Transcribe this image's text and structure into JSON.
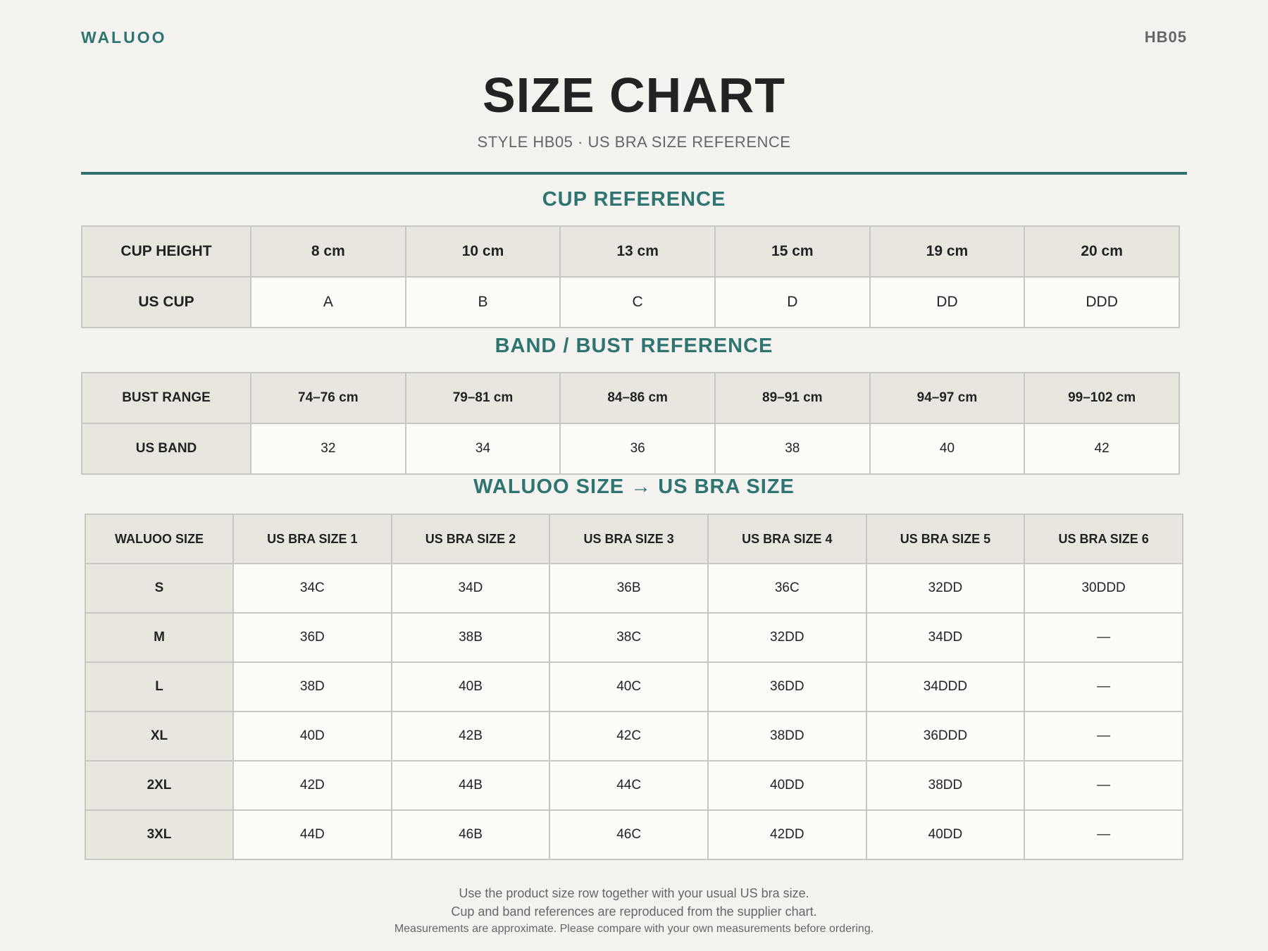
{
  "header": {
    "brand": "WALUOO",
    "code": "HB05",
    "title": "SIZE CHART",
    "subtitle": "STYLE HB05 · US BRA SIZE REFERENCE"
  },
  "colors": {
    "accent": "#2e7470",
    "header_cell_bg": "#e9e6e0",
    "cell_bg": "#fdfcf9",
    "page_bg": "#f4f3ef"
  },
  "cup_reference": {
    "title": "CUP REFERENCE",
    "row1_label": "CUP HEIGHT",
    "row1": [
      "8 cm",
      "10 cm",
      "13 cm",
      "15 cm",
      "19 cm",
      "20 cm"
    ],
    "row2_label": "US CUP",
    "row2": [
      "A",
      "B",
      "C",
      "D",
      "DD",
      "DDD"
    ]
  },
  "band_reference": {
    "title": "BAND / BUST REFERENCE",
    "row1_label": "BUST RANGE",
    "row1": [
      "74–76 cm",
      "79–81 cm",
      "84–86 cm",
      "89–91 cm",
      "94–97 cm",
      "99–102 cm"
    ],
    "row2_label": "US BAND",
    "row2": [
      "32",
      "34",
      "36",
      "38",
      "40",
      "42"
    ]
  },
  "size_map": {
    "title": "WALUOO SIZE → US BRA SIZE",
    "columns": [
      "WALUOO SIZE",
      "US BRA SIZE 1",
      "US BRA SIZE 2",
      "US BRA SIZE 3",
      "US BRA SIZE 4",
      "US BRA SIZE 5",
      "US BRA SIZE 6"
    ],
    "rows": [
      [
        "S",
        "34C",
        "34D",
        "36B",
        "36C",
        "32DD",
        "30DDD"
      ],
      [
        "M",
        "36D",
        "38B",
        "38C",
        "32DD",
        "34DD",
        "—"
      ],
      [
        "L",
        "38D",
        "40B",
        "40C",
        "36DD",
        "34DDD",
        "—"
      ],
      [
        "XL",
        "40D",
        "42B",
        "42C",
        "38DD",
        "36DDD",
        "—"
      ],
      [
        "2XL",
        "42D",
        "44B",
        "44C",
        "40DD",
        "38DD",
        "—"
      ],
      [
        "3XL",
        "44D",
        "46B",
        "46C",
        "42DD",
        "40DD",
        "—"
      ]
    ]
  },
  "footer": {
    "line1": "Use the product size row together with your usual US bra size.",
    "line2": "Cup and band references are reproduced from the supplier chart.",
    "line3": "Measurements are approximate. Please compare with your own measurements before ordering."
  }
}
